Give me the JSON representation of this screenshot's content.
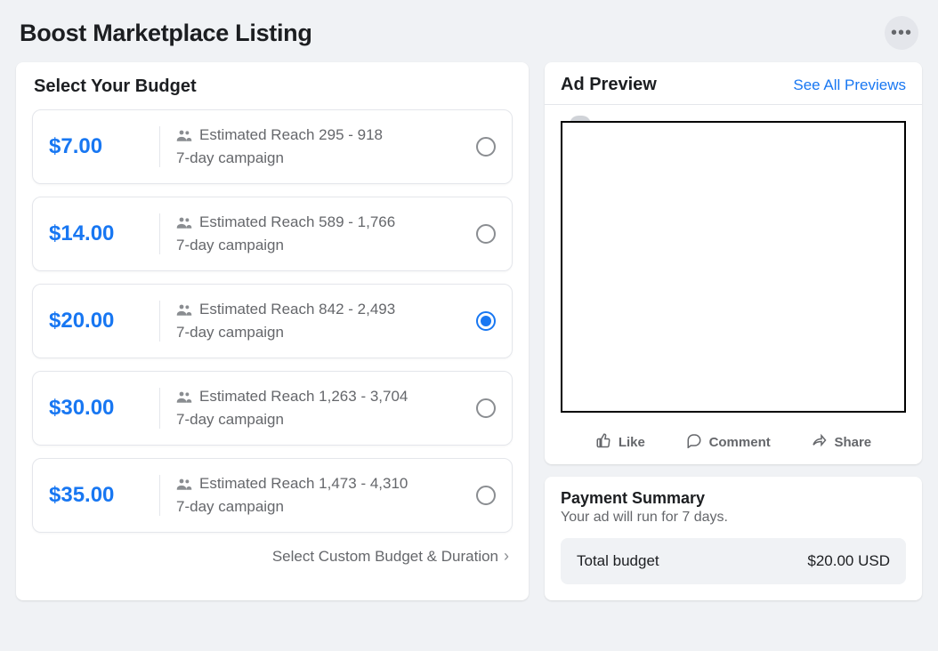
{
  "header": {
    "title": "Boost Marketplace Listing"
  },
  "budget": {
    "section_title": "Select Your Budget",
    "custom_label": "Select Custom Budget & Duration",
    "items": [
      {
        "price": "$7.00",
        "reach_label": "Estimated Reach 295 - 918",
        "campaign": "7-day campaign",
        "selected": false
      },
      {
        "price": "$14.00",
        "reach_label": "Estimated Reach 589 - 1,766",
        "campaign": "7-day campaign",
        "selected": false
      },
      {
        "price": "$20.00",
        "reach_label": "Estimated Reach 842 - 2,493",
        "campaign": "7-day campaign",
        "selected": true
      },
      {
        "price": "$30.00",
        "reach_label": "Estimated Reach 1,263 - 3,704",
        "campaign": "7-day campaign",
        "selected": false
      },
      {
        "price": "$35.00",
        "reach_label": "Estimated Reach 1,473 - 4,310",
        "campaign": "7-day campaign",
        "selected": false
      }
    ]
  },
  "preview": {
    "title": "Ad Preview",
    "see_all_label": "See All Previews",
    "like_label": "Like",
    "comment_label": "Comment",
    "share_label": "Share"
  },
  "summary": {
    "title": "Payment Summary",
    "subtitle": "Your ad will run for 7 days.",
    "total_label": "Total budget",
    "total_value": "$20.00 USD"
  }
}
